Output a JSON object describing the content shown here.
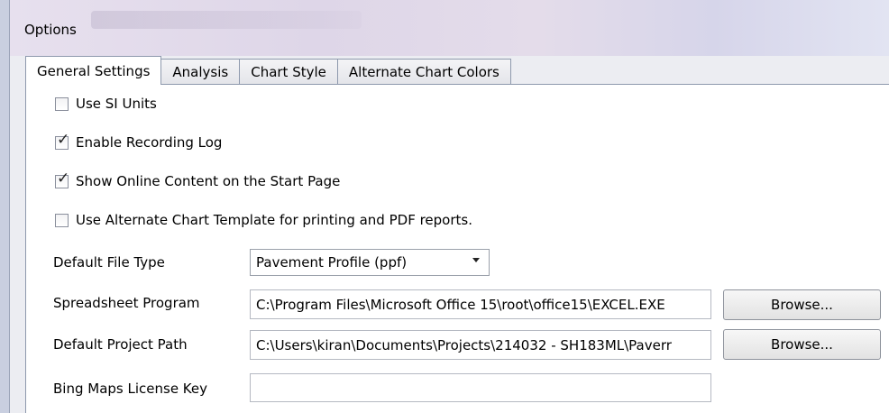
{
  "window": {
    "title": "Options"
  },
  "tabs": [
    {
      "label": "General Settings",
      "active": true
    },
    {
      "label": "Analysis",
      "active": false
    },
    {
      "label": "Chart Style",
      "active": false
    },
    {
      "label": "Alternate Chart Colors",
      "active": false
    }
  ],
  "checkboxes": [
    {
      "label": "Use SI Units",
      "checked": false
    },
    {
      "label": "Enable Recording Log",
      "checked": true
    },
    {
      "label": "Show Online Content on the Start Page",
      "checked": true
    },
    {
      "label": "Use Alternate Chart Template for printing and PDF reports.",
      "checked": false
    }
  ],
  "default_file_type": {
    "label": "Default File Type",
    "value": "Pavement Profile (ppf)"
  },
  "spreadsheet_program": {
    "label": "Spreadsheet Program",
    "value": "C:\\Program Files\\Microsoft Office 15\\root\\office15\\EXCEL.EXE",
    "browse_label": "Browse..."
  },
  "default_project_path": {
    "label": "Default Project Path",
    "value": "C:\\Users\\kiran\\Documents\\Projects\\214032 - SH183ML\\Paverr",
    "browse_label": "Browse..."
  },
  "bing_maps_key": {
    "label": "Bing Maps License Key",
    "value": ""
  },
  "icons": {
    "checkmark": "checkmark-icon",
    "dropdown": "chevron-down-icon"
  }
}
